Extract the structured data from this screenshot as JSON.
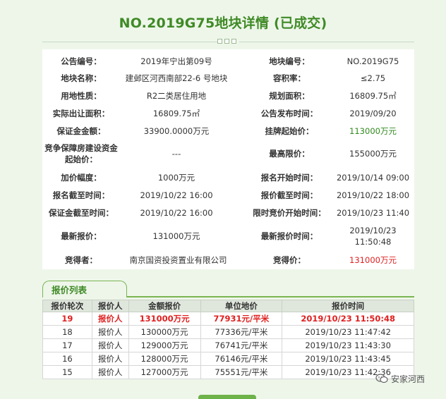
{
  "page_title": "NO.2019G75地块详情 (已成交)",
  "info_rows": [
    {
      "l1": "公告编号：",
      "v1": "2019年宁出第09号",
      "l2": "地块编号：",
      "v2": "NO.2019G75"
    },
    {
      "l1": "地块名称：",
      "v1": "建邺区河西南部22-6 号地块",
      "l2": "容积率：",
      "v2": "≤2.75"
    },
    {
      "l1": "用地性质：",
      "v1": "R2二类居住用地",
      "l2": "规划面积：",
      "v2": "16809.75㎡"
    },
    {
      "l1": "实际出让面积：",
      "v1": "16809.75㎡",
      "l2": "公告发布时间：",
      "v2": "2019/09/20"
    },
    {
      "l1": "保证金金额：",
      "v1": "33900.0000万元",
      "l2": "挂牌起始价：",
      "v2": "113000万元"
    },
    {
      "l1": "竞争保障房建设资金起始价：",
      "v1": "---",
      "l2": "最高限价：",
      "v2": "155000万元"
    },
    {
      "l1": "加价幅度：",
      "v1": "1000万元",
      "l2": "报名开始时间：",
      "v2": "2019/10/14 09:00"
    },
    {
      "l1": "报名截至时间：",
      "v1": "2019/10/22 16:00",
      "l2": "报价截至时间：",
      "v2": "2019/10/22 18:00"
    },
    {
      "l1": "保证金截至时间：",
      "v1": "2019/10/22 16:00",
      "l2": "限时竞价开始时间：",
      "v2": "2019/10/23 11:40"
    },
    {
      "l1": "最新报价：",
      "v1": "131000万元",
      "l2": "最新报价时间：",
      "v2": "2019/10/23 11:50:48"
    },
    {
      "l1": "竞得者：",
      "v1": "南京国资投资置业有限公司",
      "l2": "竞得价：",
      "v2": "131000万元"
    }
  ],
  "bid_tab_label": "报价列表",
  "bid_headers": [
    "报价轮次",
    "报价人",
    "金额报价",
    "单位地价",
    "报价时间"
  ],
  "bids": [
    {
      "round": "19",
      "bidder": "报价人",
      "amount": "131000万元",
      "unit_price": "77931元/平米",
      "time": "2019/10/23 11:50:48"
    },
    {
      "round": "18",
      "bidder": "报价人",
      "amount": "130000万元",
      "unit_price": "77336元/平米",
      "time": "2019/10/23 11:47:42"
    },
    {
      "round": "17",
      "bidder": "报价人",
      "amount": "129000万元",
      "unit_price": "76741元/平米",
      "time": "2019/10/23 11:43:30"
    },
    {
      "round": "16",
      "bidder": "报价人",
      "amount": "128000万元",
      "unit_price": "76146元/平米",
      "time": "2019/10/23 11:43:45"
    },
    {
      "round": "15",
      "bidder": "报价人",
      "amount": "127000万元",
      "unit_price": "75551元/平米",
      "time": "2019/10/23 11:42:36"
    }
  ],
  "watermark_text": "安家河西",
  "colors": {
    "title_green": "#3f8a26",
    "price_green": "#2f8a1c",
    "highlight_red": "#e02020"
  }
}
